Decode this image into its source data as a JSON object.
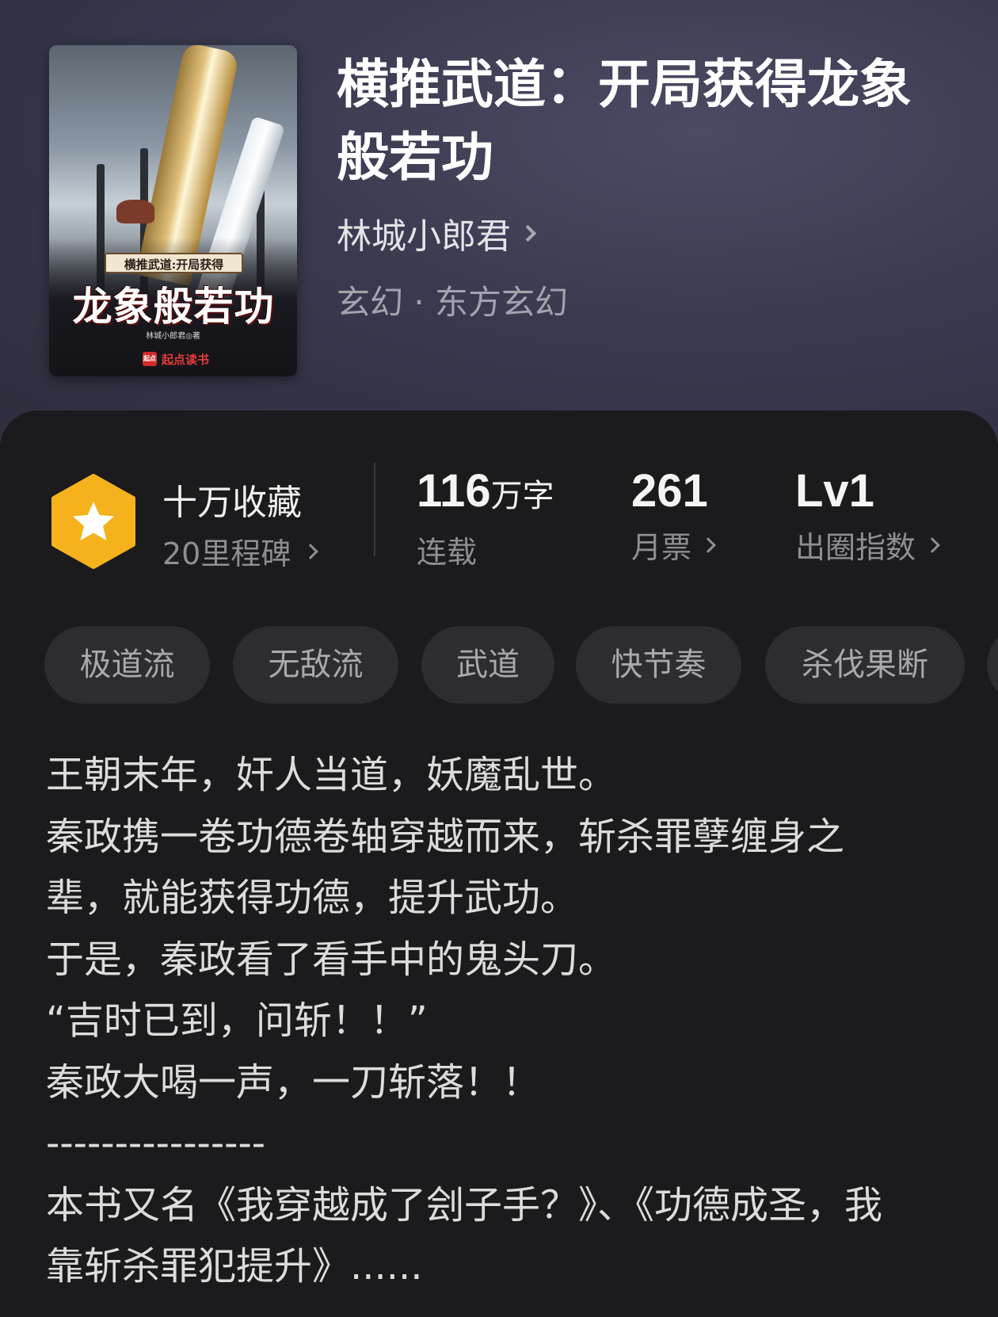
{
  "book": {
    "title": "横推武道：开局获得龙象般若功",
    "author": "林城小郎君",
    "genre": "玄幻 · 东方玄幻",
    "cover": {
      "sub_title": "横推武道:开局获得",
      "big_title": "龙象般若功",
      "author_line": "林城小郎君◎著",
      "publisher": "起点读书",
      "publisher_logo": "起点"
    }
  },
  "stats": {
    "collect": {
      "title": "十万收藏",
      "milestone": "20里程碑",
      "icon": "star-hexagon-icon",
      "color": "#f5b21d"
    },
    "words": {
      "value": "116",
      "unit": "万字",
      "label": "连载"
    },
    "monthly_votes": {
      "value": "261",
      "label": "月票"
    },
    "popularity": {
      "value": "Lv1",
      "label": "出圈指数"
    }
  },
  "tags": [
    "极道流",
    "无敌流",
    "武道",
    "快节奏",
    "杀伐果断"
  ],
  "description": [
    "王朝末年，奸人当道，妖魔乱世。",
    "秦政携一卷功德卷轴穿越而来，斩杀罪孽缠身之",
    "辈，就能获得功德，提升武功。",
    "于是，秦政看了看手中的鬼头刀。",
    "“吉时已到，问斩！！”",
    "秦政大喝一声，一刀斩落！！",
    "----------------",
    "本书又名《我穿越成了刽子手？》、《功德成圣，我",
    "靠斩杀罪犯提升》......"
  ],
  "colors": {
    "panel": "#1b1b1d",
    "tag_bg": "#2d2d30",
    "badge": "#f5b21d"
  }
}
